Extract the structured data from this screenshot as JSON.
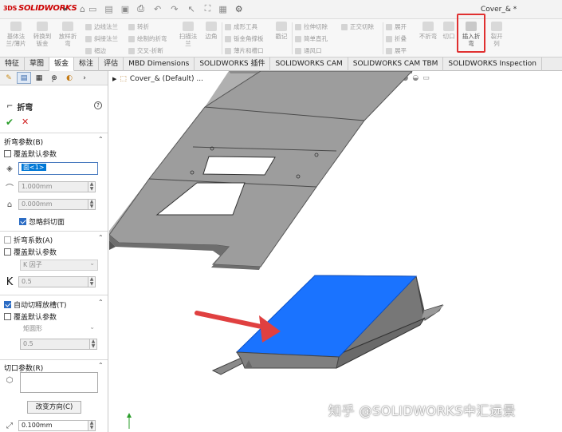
{
  "titlebar": {
    "app_name": "SOLIDWORKS",
    "app_prefix": "3DS",
    "document_title": "Cover_& *"
  },
  "ribbon": {
    "groups": [
      {
        "label1": "基体法",
        "label2": "兰/薄片"
      },
      {
        "label1": "转换到",
        "label2": "钣金"
      },
      {
        "label1": "放样折",
        "label2": "弯"
      },
      {
        "label1": "边线法兰"
      },
      {
        "label1": "斜接法兰"
      },
      {
        "label1": "褶边"
      },
      {
        "label1": "转折"
      },
      {
        "label1": "绘制的折弯"
      },
      {
        "label1": "交叉-折断"
      },
      {
        "label1": "扫描法",
        "label2": "兰"
      },
      {
        "label1": "边角"
      },
      {
        "label1": "成形工具"
      },
      {
        "label1": "钣金角撑板"
      },
      {
        "label1": "薄片和槽口"
      },
      {
        "label1": "戳记"
      },
      {
        "label1": "拉伸切除"
      },
      {
        "label1": "简单直孔"
      },
      {
        "label1": "通风口"
      },
      {
        "label1": "正交切除"
      },
      {
        "label1": "展开"
      },
      {
        "label1": "折叠"
      },
      {
        "label1": "展平"
      },
      {
        "label1": "不折弯"
      },
      {
        "label1": "切口"
      },
      {
        "label1": "插入折",
        "label2": "弯"
      },
      {
        "label1": "裂开",
        "label2": "列"
      }
    ]
  },
  "tabs": [
    "特征",
    "草图",
    "钣金",
    "标注",
    "评估",
    "MBD Dimensions",
    "SOLIDWORKS 插件",
    "SOLIDWORKS CAM",
    "SOLIDWORKS CAM TBM",
    "SOLIDWORKS Inspection"
  ],
  "panel": {
    "title": "折弯",
    "help": "?",
    "bend_params": {
      "heading": "折弯参数(B)",
      "override": "覆盖默认参数",
      "face_value": "面<1>",
      "radius": "1.000mm",
      "thickness": "0.000mm",
      "ignore_bevel": "忽略斜切面"
    },
    "allowance": {
      "heading": "折弯系数(A)",
      "override": "覆盖默认参数",
      "type": "K 因子",
      "k_label": "K",
      "k_value": "0.5"
    },
    "relief": {
      "heading": "自动切释放槽(T)",
      "override": "覆盖默认参数",
      "type": "矩圆形",
      "ratio": "0.5"
    },
    "rip": {
      "heading": "切口参数(R)",
      "change_dir": "改变方向(C)",
      "gap": "0.100mm"
    }
  },
  "graphics": {
    "tree_label": "Cover_& (Default) ...",
    "watermark": "知乎 @SOLIDWORKS中汇远景"
  },
  "colors": {
    "selected_face": "#1a73ff",
    "arrow": "#e04040",
    "part_fill": "#9a9a9a"
  }
}
